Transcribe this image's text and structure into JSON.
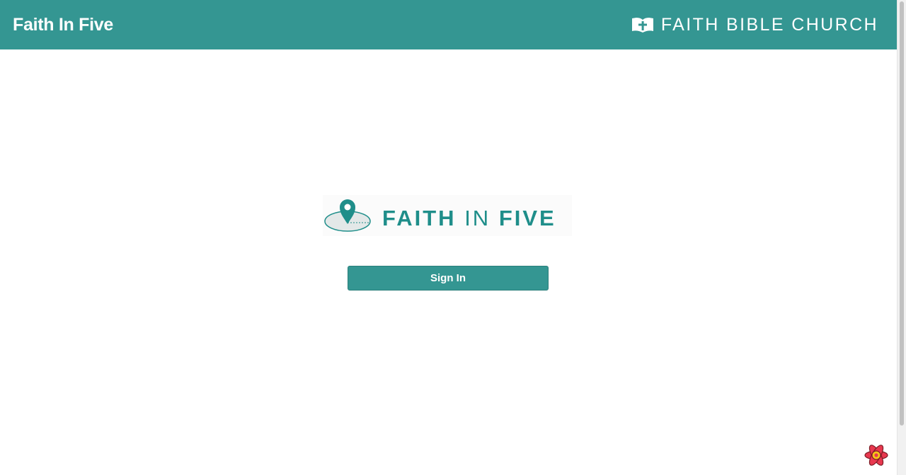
{
  "header": {
    "app_title": "Faith In Five",
    "church_name": "FAITH BIBLE CHURCH",
    "church_logo_icon": "open-book-cross-icon"
  },
  "main": {
    "logo": {
      "word_faith": "FAITH",
      "word_in": "IN",
      "word_five": "FIVE",
      "icon": "map-pin-icon"
    },
    "sign_in_label": "Sign In"
  },
  "corner_widget": {
    "icon": "react-devtools-icon"
  },
  "colors": {
    "brand_teal": "#349692",
    "logo_teal": "#1f8e8a",
    "background": "#ffffff"
  }
}
